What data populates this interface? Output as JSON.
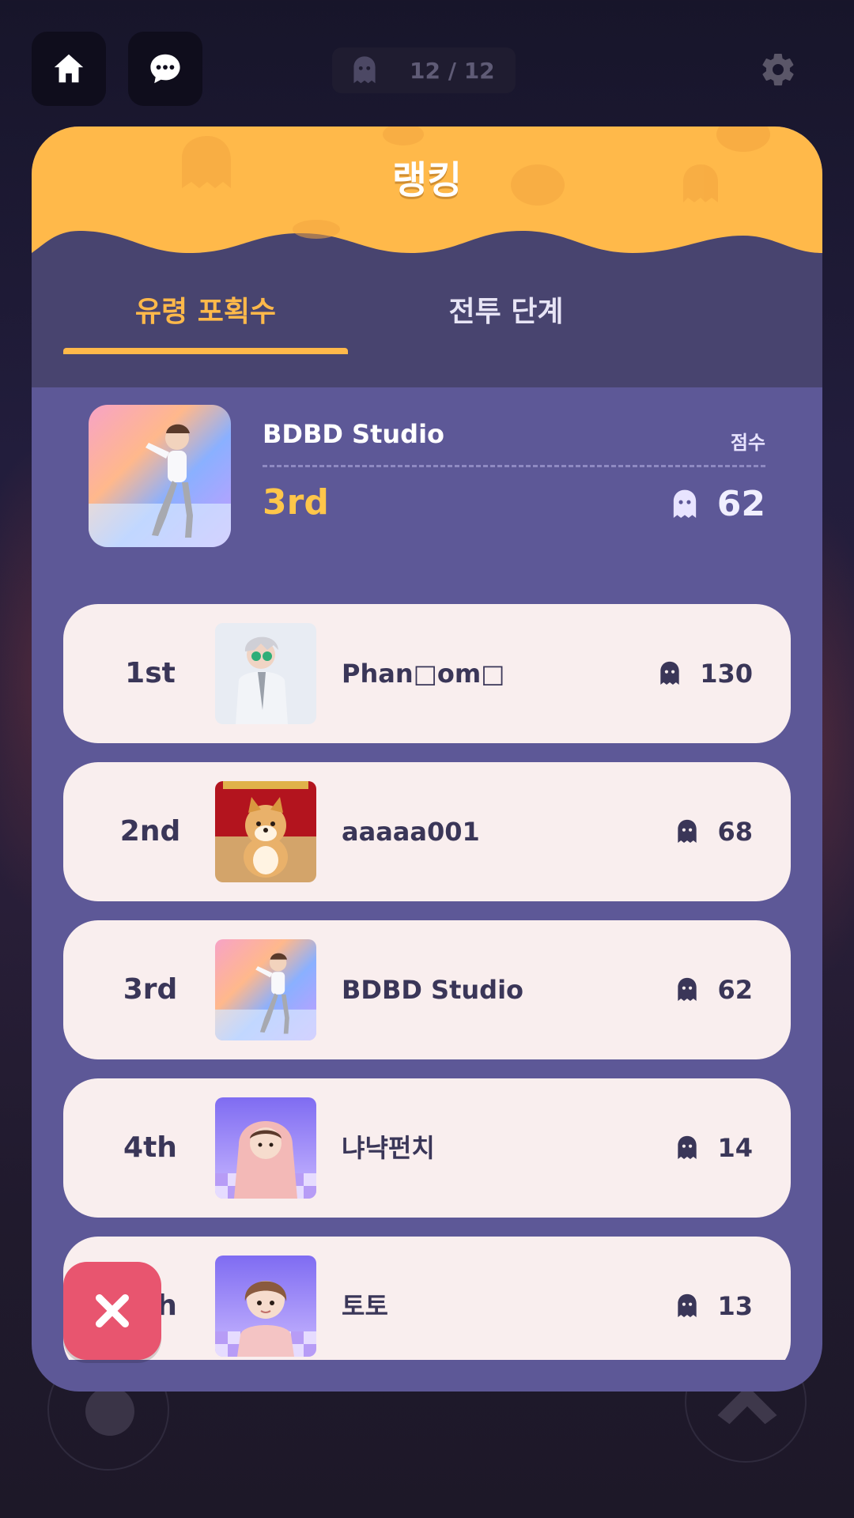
{
  "hud": {
    "home_icon": "home-icon",
    "chat_icon": "chat-bubble-icon",
    "settings_icon": "gear-icon",
    "ghost_counter": "12 / 12"
  },
  "modal": {
    "title": "랭킹",
    "tabs": [
      {
        "label": "유령 포획수",
        "active": true
      },
      {
        "label": "전투 단계",
        "active": false
      }
    ],
    "my_rank": {
      "name": "BDBD Studio",
      "score_label": "점수",
      "rank": "3rd",
      "score": "62"
    },
    "ranking": [
      {
        "rank": "1st",
        "name": "Phan□om□",
        "score": "130"
      },
      {
        "rank": "2nd",
        "name": "aaaaa001",
        "score": "68"
      },
      {
        "rank": "3rd",
        "name": "BDBD Studio",
        "score": "62"
      },
      {
        "rank": "4th",
        "name": "냐냑펀치",
        "score": "14"
      },
      {
        "rank": "5th",
        "name": "토토",
        "score": "13"
      }
    ]
  },
  "colors": {
    "header_orange": "#ffb94a",
    "modal_purple": "#5d5897",
    "row_bg": "#f9eeee",
    "close_red": "#e8556f"
  }
}
